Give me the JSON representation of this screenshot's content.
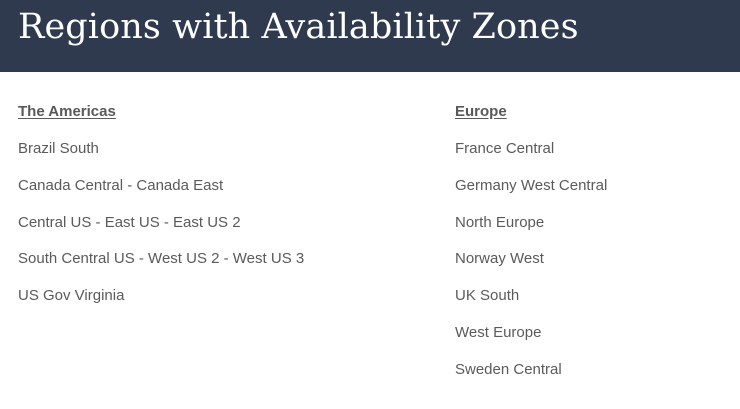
{
  "header": {
    "title": "Regions with Availability Zones"
  },
  "columns": [
    {
      "heading": "The Americas",
      "regions": [
        "Brazil South",
        "Canada Central - Canada East",
        "Central US - East US - East US 2",
        "South Central US - West US 2 - West US 3",
        "US Gov Virginia"
      ]
    },
    {
      "heading": "Europe",
      "regions": [
        "France Central",
        "Germany West Central",
        "North Europe",
        "Norway West",
        "UK South",
        "West Europe",
        "Sweden Central"
      ]
    }
  ],
  "colors": {
    "header_background": "#2f3a4e",
    "header_text": "#ffffff",
    "body_text": "#5a5a5a"
  }
}
